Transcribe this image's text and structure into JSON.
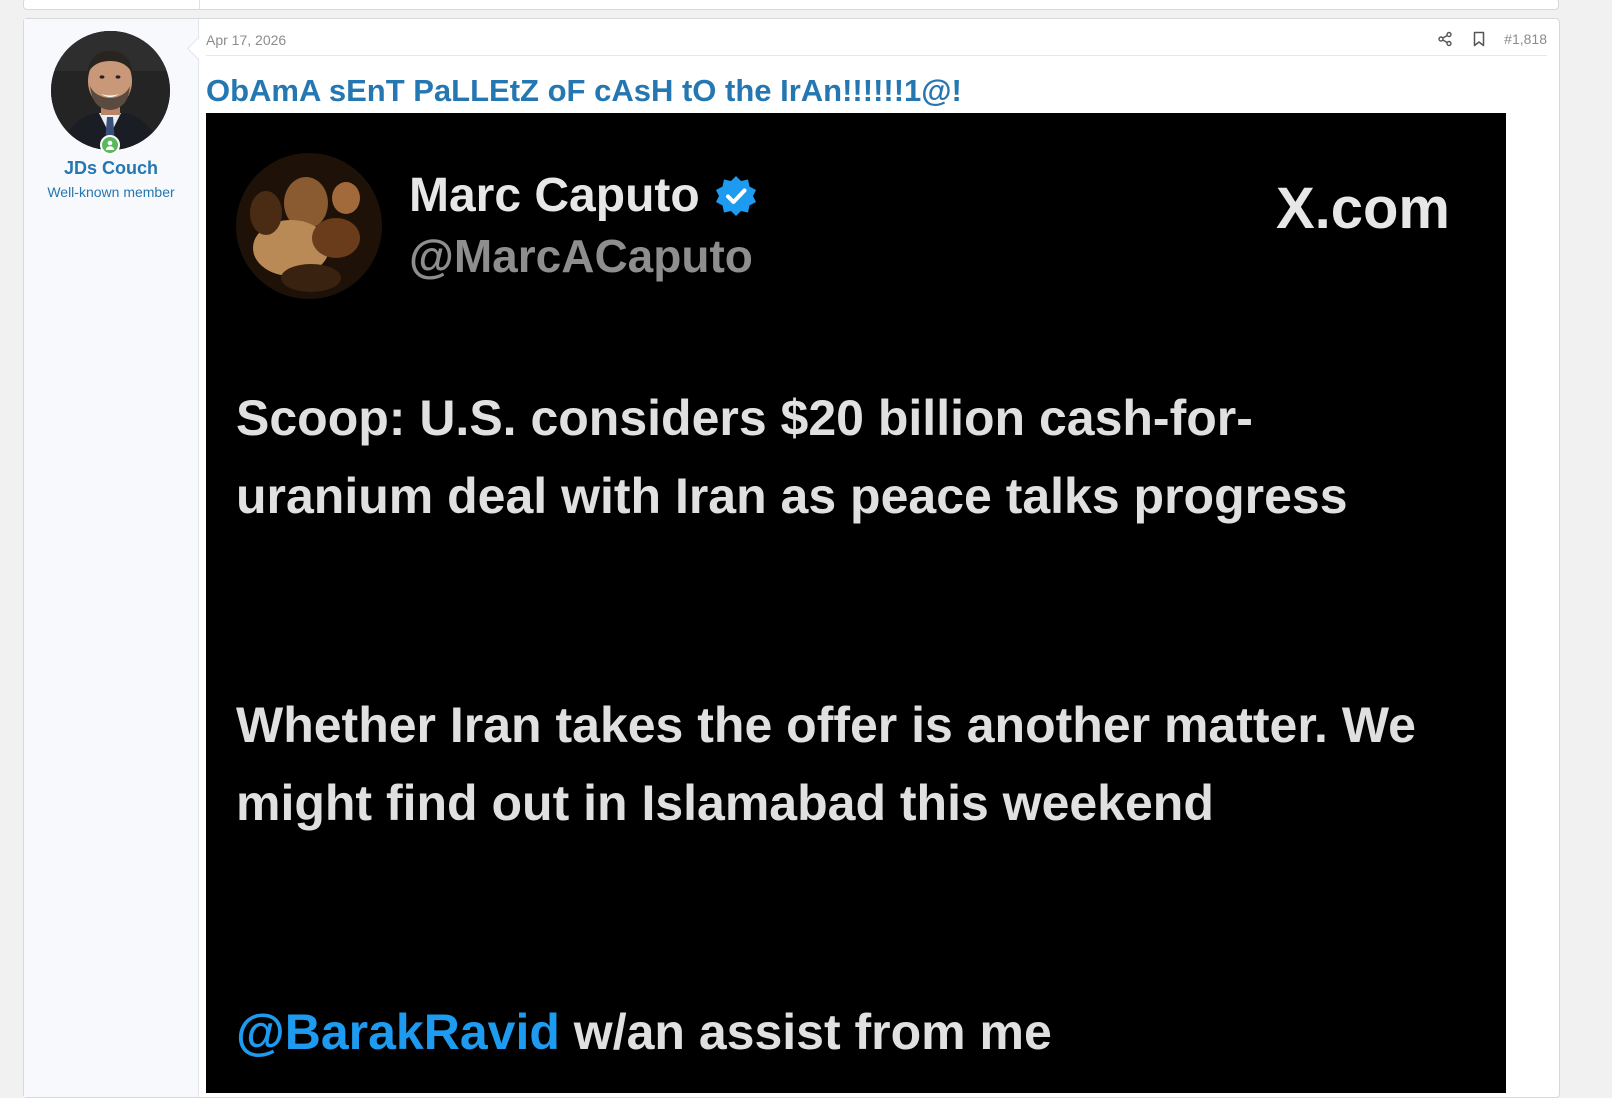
{
  "post": {
    "date": "Apr 17, 2026",
    "post_number": "#1,818",
    "title": "ObAmA sEnT PaLLEtZ oF cAsH tO the IrAn!!!!!!1@!"
  },
  "user": {
    "name": "JDs Couch",
    "role": "Well-known member"
  },
  "tweet": {
    "display_name": "Marc Caputo",
    "handle": "@MarcACaputo",
    "site": "X.com",
    "para1": "Scoop: U.S. considers $20 billion cash-for-uranium deal with Iran as peace talks progress",
    "para2": "Whether Iran takes the offer is another matter. We might find out in Islamabad this weekend",
    "mention": "@BarakRavid",
    "para3_rest": " w/an assist from me"
  }
}
